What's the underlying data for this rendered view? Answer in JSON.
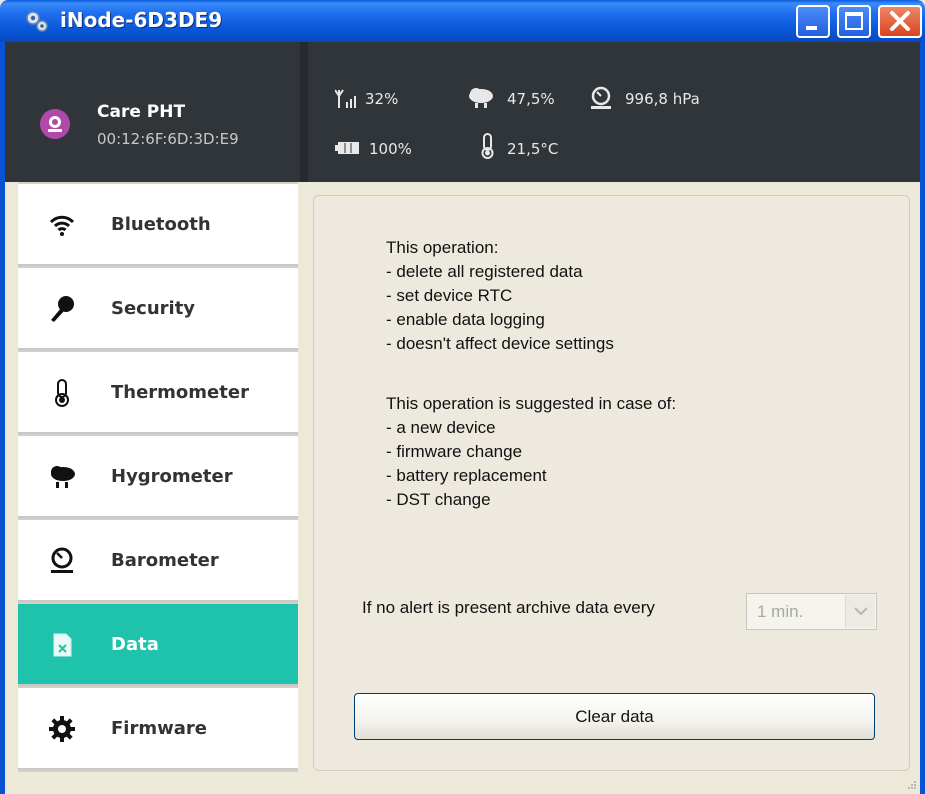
{
  "window": {
    "title": "iNode-6D3DE9",
    "icon": "gears-icon",
    "controls": [
      "minimize-icon",
      "maximize-icon",
      "close-icon"
    ]
  },
  "device": {
    "name": "Care PHT",
    "mac": "00:12:6F:6D:3D:E9",
    "icon": "sensor-avatar-icon"
  },
  "stats": {
    "signal": "32%",
    "humidity": "47,5%",
    "pressure": "996,8 hPa",
    "battery": "100%",
    "temperature": "21,5°C"
  },
  "sidebar": {
    "items": [
      {
        "label": "Bluetooth",
        "icon": "wifi-icon"
      },
      {
        "label": "Security",
        "icon": "key-icon"
      },
      {
        "label": "Thermometer",
        "icon": "thermometer-icon"
      },
      {
        "label": "Hygrometer",
        "icon": "rain-cloud-icon"
      },
      {
        "label": "Barometer",
        "icon": "gauge-icon"
      },
      {
        "label": "Data",
        "icon": "data-file-icon",
        "active": true
      },
      {
        "label": "Firmware",
        "icon": "gear-icon"
      }
    ]
  },
  "content": {
    "lines": [
      "This operation:",
      "- delete all registered data",
      "- set device RTC",
      "- enable data logging",
      "- doesn't affect device settings",
      "",
      "This operation is suggested in case of:",
      "- a new device",
      "- firmware change",
      "- battery replacement",
      "- DST change"
    ],
    "archive_label": "If no alert is present archive data every",
    "archive_interval": "1 min.",
    "clear_button": "Clear data"
  },
  "colors": {
    "accent": "#1fc2ab",
    "header_bg": "#30353a",
    "titlebar": "#0a58d8"
  }
}
